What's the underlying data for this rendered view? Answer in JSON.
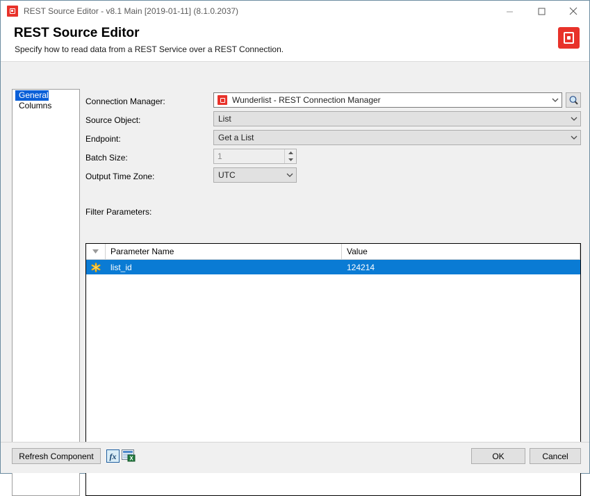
{
  "window": {
    "title": "REST Source Editor - v8.1 Main [2019-01-11] (8.1.0.2037)",
    "app_icon": "rest-source-icon",
    "controls": {
      "minimize": "minimize-icon",
      "maximize": "maximize-icon",
      "close": "close-icon"
    }
  },
  "header": {
    "title": "REST Source Editor",
    "subtitle": "Specify how to read data from a REST Service over a REST Connection.",
    "brand_icon": "zappysys-logo-icon",
    "brand_color": "#e8322a"
  },
  "sidebar": {
    "items": [
      {
        "label": "General",
        "selected": true
      },
      {
        "label": "Columns",
        "selected": false
      }
    ],
    "selected_color": "#0a5fd8"
  },
  "form": {
    "connection_manager": {
      "label": "Connection Manager:",
      "value": "Wunderlist - REST Connection Manager",
      "icon": "connection-manager-icon",
      "chevron": "chevron-down-icon",
      "browse_icon": "magnifier-icon"
    },
    "source_object": {
      "label": "Source Object:",
      "value": "List",
      "chevron": "chevron-down-icon"
    },
    "endpoint": {
      "label": "Endpoint:",
      "value": "Get a List",
      "chevron": "chevron-down-icon"
    },
    "batch_size": {
      "label": "Batch Size:",
      "value": "1",
      "disabled": true
    },
    "output_time_zone": {
      "label": "Output Time Zone:",
      "value": "UTC",
      "chevron": "chevron-down-icon"
    },
    "filter_parameters_label": "Filter Parameters:"
  },
  "grid": {
    "sort_icon": "filter-triangle-icon",
    "columns": [
      "Parameter Name",
      "Value"
    ],
    "rows": [
      {
        "marker": "new-row-asterisk-icon",
        "parameter_name": "list_id",
        "value": "124214",
        "selected": true
      }
    ],
    "selection_color": "#0a7bd4"
  },
  "footer": {
    "refresh_label": "Refresh Component",
    "expression_icon": "fx-expression-icon",
    "preview_icon": "data-preview-icon",
    "ok_label": "OK",
    "cancel_label": "Cancel"
  }
}
